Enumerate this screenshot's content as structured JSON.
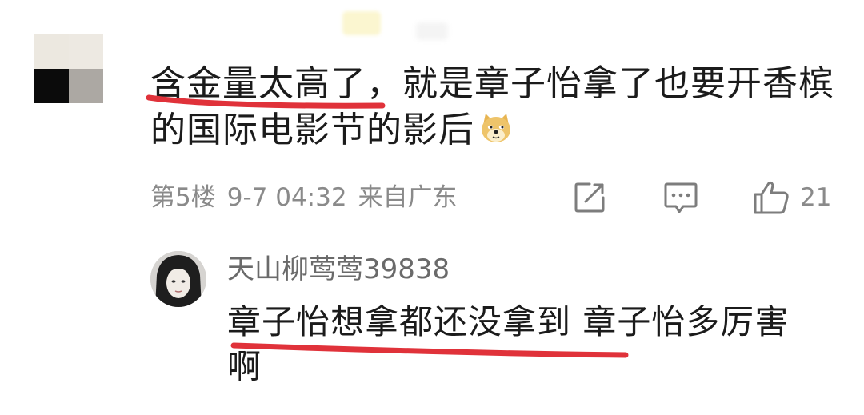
{
  "main_comment": {
    "text_line_1": "含金量太高了，就是章子怡拿了也要开香槟",
    "text_line_2": "的国际电影节的影后",
    "emoji": "doge-emoji",
    "floor": "第5楼",
    "date": "9-7 04:32",
    "location": "来自广东",
    "like_count": "21",
    "icons": [
      "share-icon",
      "reply-icon",
      "thumbs-up-icon"
    ]
  },
  "reply": {
    "username": "天山柳莺莺39838",
    "text_line_1": "章子怡想拿都还没拿到 章子怡多厉害",
    "text_line_2": "啊"
  },
  "colors": {
    "underline": "#e0323a",
    "meta_text": "#8a8a8a",
    "body_text": "#1b1b1b"
  }
}
